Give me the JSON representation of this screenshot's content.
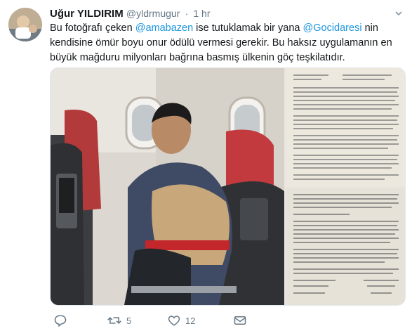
{
  "tweet": {
    "author_name": "Uğur YILDIRIM",
    "author_handle": "@yldrmugur",
    "separator": "·",
    "time": "1 hr",
    "text_segments": [
      "Bu fotoğrafı çeken ",
      "@amabazen",
      " ise tutuklamak bir yana ",
      "@Gocidaresi",
      " nin kendisine ömür boyu onur ödülü vermesi gerekir. Bu haksız uygulamanın en büyük mağduru milyonları bağrına basmış ülkenin göç teşkilatıdır."
    ]
  },
  "actions": {
    "reply_count": "",
    "retweet_count": "5",
    "like_count": "12"
  },
  "icons": {
    "reply": "reply-icon",
    "retweet": "retweet-icon",
    "like": "heart-icon",
    "message": "envelope-icon",
    "caret": "chevron-down-icon"
  },
  "colors": {
    "link": "#1b95e0",
    "muted": "#657786",
    "text": "#14171a"
  }
}
